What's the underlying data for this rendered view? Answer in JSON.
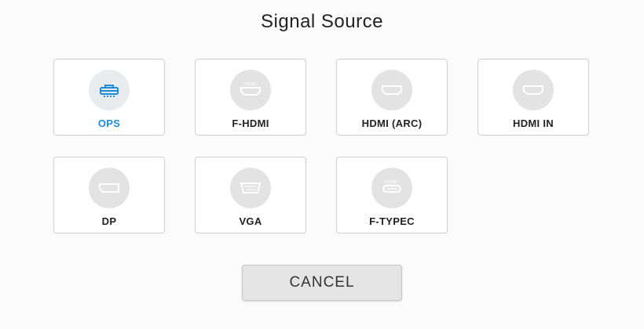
{
  "dialog": {
    "title": "Signal Source",
    "accent_color": "#1f8ad8",
    "sources": [
      {
        "label": "OPS",
        "icon": "ops-icon",
        "active": true
      },
      {
        "label": "F-HDMI",
        "icon": "front-hdmi-icon",
        "icon_text": "FRONT",
        "active": false
      },
      {
        "label": "HDMI (ARC)",
        "icon": "hdmi-icon",
        "active": false
      },
      {
        "label": "HDMI IN",
        "icon": "hdmi-icon",
        "active": false
      },
      {
        "label": "DP",
        "icon": "displayport-icon",
        "active": false
      },
      {
        "label": "VGA",
        "icon": "vga-icon",
        "active": false
      },
      {
        "label": "F-TYPEC",
        "icon": "front-typec-icon",
        "icon_text": "FRONT",
        "active": false
      }
    ],
    "cancel_label": "CANCEL"
  }
}
